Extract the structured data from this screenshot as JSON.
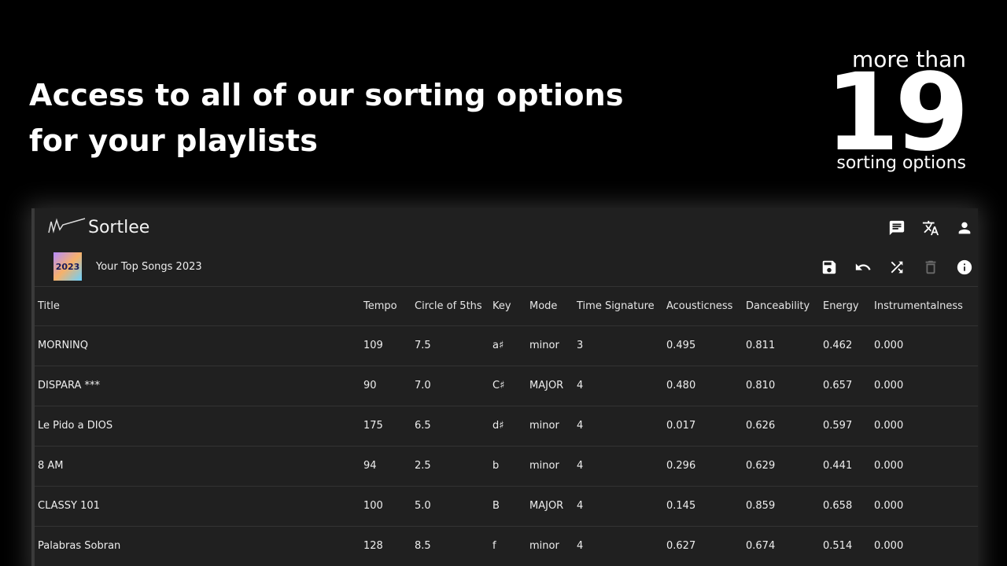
{
  "headline": {
    "line1": "Access to all of our sorting options",
    "line2": "for your playlists"
  },
  "promo": {
    "top": "more than",
    "number": "19",
    "bottom": "sorting options"
  },
  "app": {
    "brand": "Sortlee",
    "header_icons": [
      "feedback-icon",
      "translate-icon",
      "account-icon"
    ],
    "playlist": {
      "cover_text": "2023",
      "name": "Your Top Songs 2023",
      "actions": [
        "save-icon",
        "undo-icon",
        "shuffle-icon",
        "delete-icon",
        "info-icon"
      ]
    },
    "table": {
      "headers": [
        "Title",
        "Tempo",
        "Circle of 5ths",
        "Key",
        "Mode",
        "Time Signature",
        "Acousticness",
        "Danceability",
        "Energy",
        "Instrumentalness"
      ],
      "rows": [
        [
          "MORNINQ",
          "109",
          "7.5",
          "a♯",
          "minor",
          "3",
          "0.495",
          "0.811",
          "0.462",
          "0.000"
        ],
        [
          "DISPARA ***",
          "90",
          "7.0",
          "C♯",
          "MAJOR",
          "4",
          "0.480",
          "0.810",
          "0.657",
          "0.000"
        ],
        [
          "Le Pido a DIOS",
          "175",
          "6.5",
          "d♯",
          "minor",
          "4",
          "0.017",
          "0.626",
          "0.597",
          "0.000"
        ],
        [
          "8 AM",
          "94",
          "2.5",
          "b",
          "minor",
          "4",
          "0.296",
          "0.629",
          "0.441",
          "0.000"
        ],
        [
          "CLASSY 101",
          "100",
          "5.0",
          "B",
          "MAJOR",
          "4",
          "0.145",
          "0.859",
          "0.658",
          "0.000"
        ],
        [
          "Palabras Sobran",
          "128",
          "8.5",
          "f",
          "minor",
          "4",
          "0.627",
          "0.674",
          "0.514",
          "0.000"
        ]
      ]
    }
  }
}
